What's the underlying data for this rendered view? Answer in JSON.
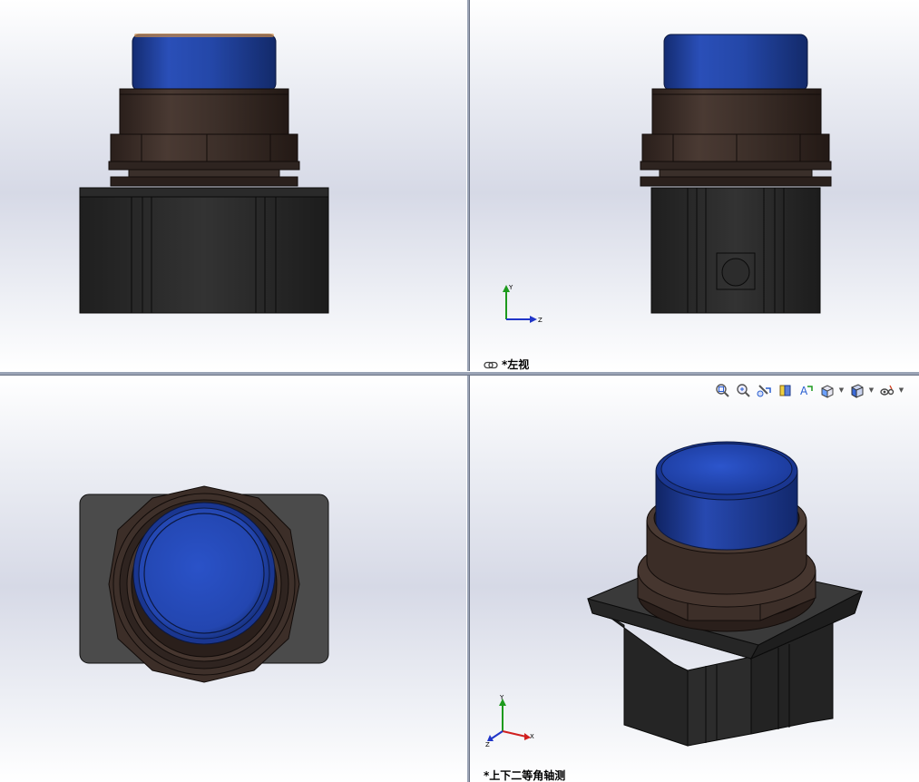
{
  "viewports": {
    "front": {
      "label": ""
    },
    "left": {
      "label": "*左视"
    },
    "top": {
      "label": ""
    },
    "isometric": {
      "label": "*上下二等角轴测"
    }
  },
  "triad_labels": {
    "x": "X",
    "y": "Y",
    "z": "Z"
  },
  "heads_up_toolbar": {
    "buttons": [
      "zoom-to-fit-icon",
      "zoom-to-area-icon",
      "previous-view-icon",
      "section-view-icon",
      "dynamic-annotation-views-icon",
      "view-orientation-icon",
      "display-style-icon",
      "hide-show-items-icon"
    ]
  },
  "colors": {
    "button_blue": "#1f3f9e",
    "nut_brown": "#3a2c26",
    "body_black": "#2c2c2c",
    "axis_x": "#d02020",
    "axis_y": "#1d9a1d",
    "axis_z": "#2035c8"
  }
}
